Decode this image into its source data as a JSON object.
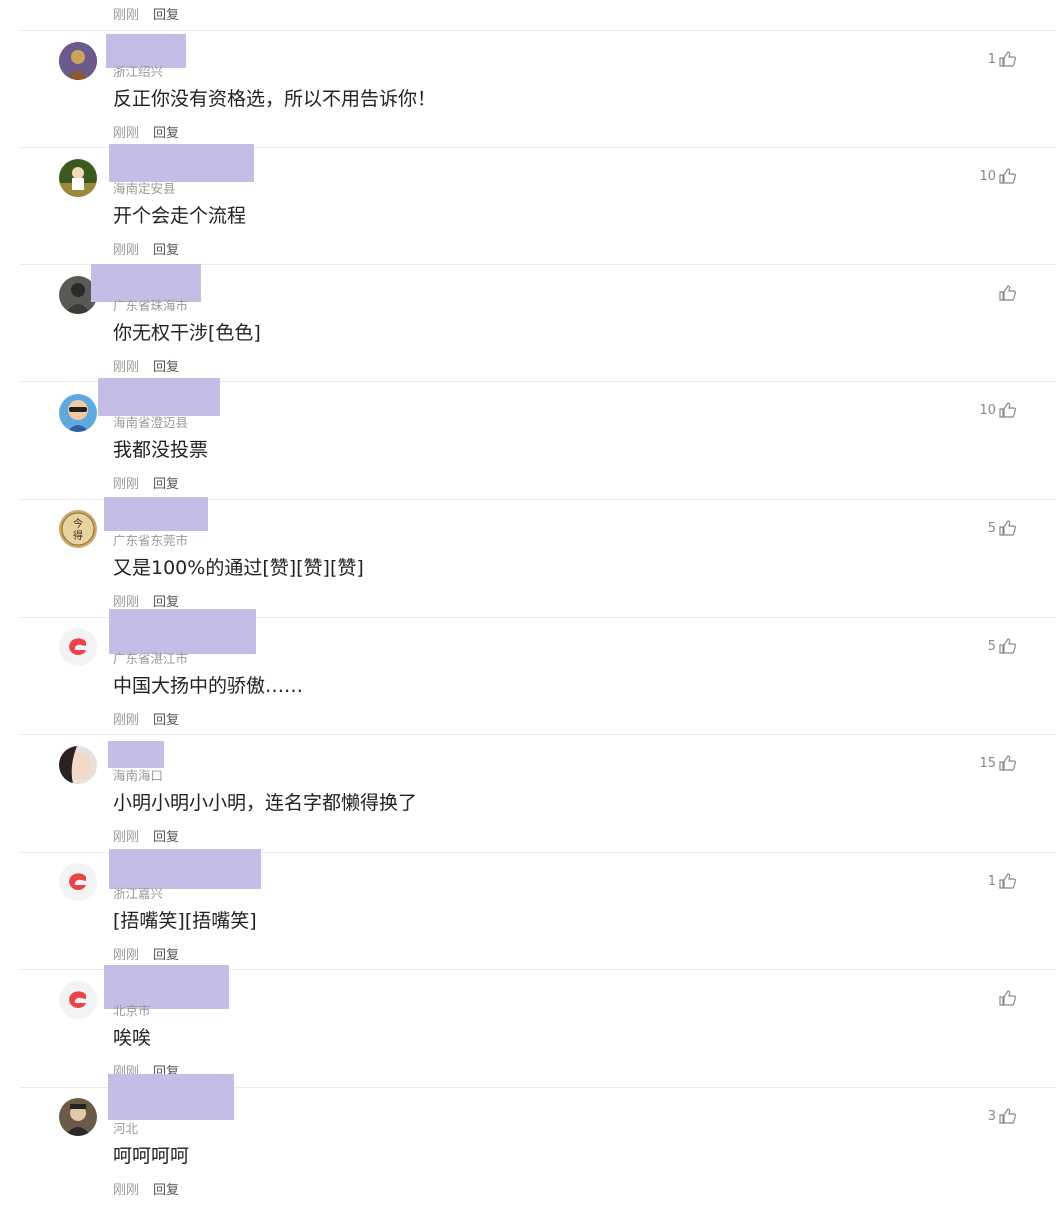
{
  "top_actions": {
    "time": "刚刚",
    "reply": "回复"
  },
  "comments": [
    {
      "location": "浙江绍兴",
      "text": "反正你没有资格选，所以不用告诉你！",
      "time": "刚刚",
      "reply": "回复",
      "likes": "1",
      "avatar_color": "#6b5a8a"
    },
    {
      "location": "海南定安县",
      "text": "开个会走个流程",
      "time": "刚刚",
      "reply": "回复",
      "likes": "10",
      "avatar_color": "#4a6b2a"
    },
    {
      "location": "广东省珠海市",
      "text": "你无权干涉[色色]",
      "time": "刚刚",
      "reply": "回复",
      "likes": "",
      "avatar_color": "#4a4a48"
    },
    {
      "location": "海南省澄迈县",
      "text": "我都没投票",
      "time": "刚刚",
      "reply": "回复",
      "likes": "10",
      "avatar_color": "#3b7dc4"
    },
    {
      "location": "广东省东莞市",
      "text": "又是100%的通过[赞][赞][赞]",
      "time": "刚刚",
      "reply": "回复",
      "likes": "5",
      "avatar_color": "#c9a96a"
    },
    {
      "location": "广东省湛江市",
      "text": "中国大扬中的骄傲……",
      "time": "刚刚",
      "reply": "回复",
      "likes": "5",
      "avatar_color": "#f3f3f3"
    },
    {
      "location": "海南海口",
      "text": "小明小明小小明，连名字都懒得换了",
      "time": "刚刚",
      "reply": "回复",
      "likes": "15",
      "avatar_color": "#d8c8c0"
    },
    {
      "location": "浙江嘉兴",
      "text": "[捂嘴笑][捂嘴笑]",
      "time": "刚刚",
      "reply": "回复",
      "likes": "1",
      "avatar_color": "#f3f3f3"
    },
    {
      "location": "北京市",
      "text": "唉唉",
      "time": "刚刚",
      "reply": "回复",
      "likes": "",
      "avatar_color": "#f3f3f3"
    },
    {
      "location": "河北",
      "text": "呵呵呵呵",
      "time": "刚刚",
      "reply": "回复",
      "likes": "3",
      "avatar_color": "#5a4a3a"
    }
  ],
  "icons": {
    "like": "thumbs-up-icon",
    "default_avatar": "red-swirl-logo-icon"
  }
}
